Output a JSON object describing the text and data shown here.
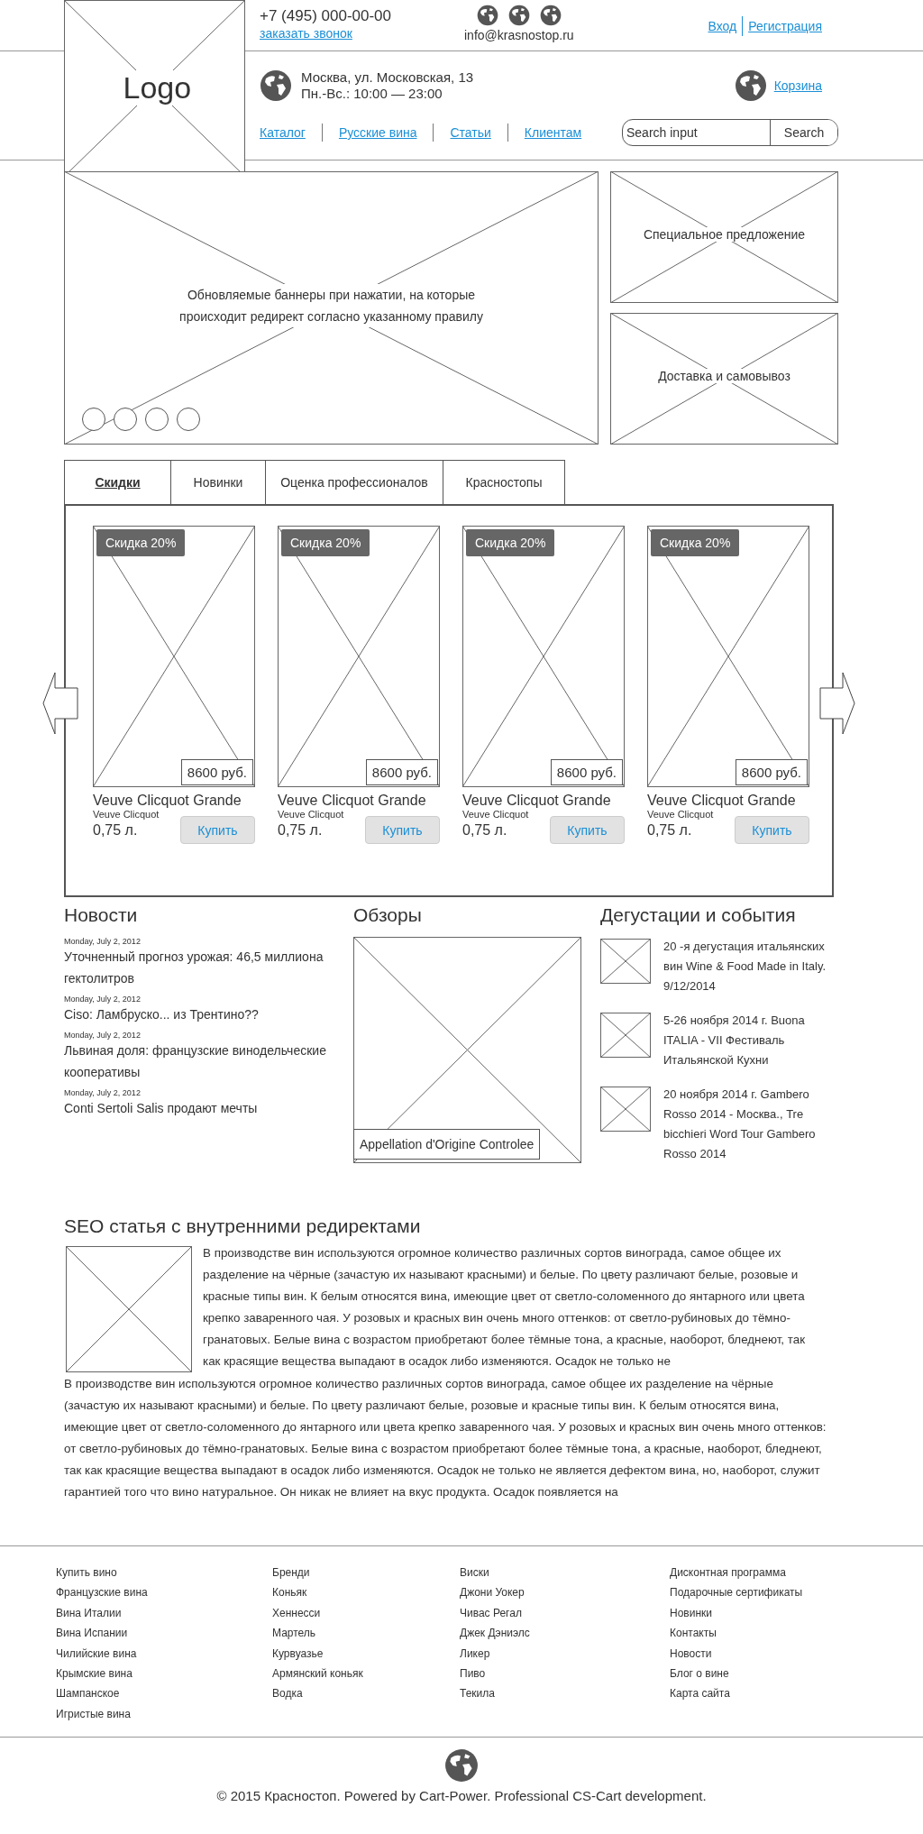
{
  "header": {
    "logo": "Logo",
    "phone": "+7 (495) 000-00-00",
    "callback_link": "заказать звонок",
    "email": "info@krasnostop.ru",
    "auth": [
      "Вход",
      "Регистрация"
    ],
    "address": "Москва, ул. Московская, 13",
    "hours": "Пн.-Вс.: 10:00 — 23:00",
    "cart": "Корзина"
  },
  "nav": [
    "Каталог",
    "Русские вина",
    "Статьи",
    "Клиентам"
  ],
  "search": {
    "placeholder": "Search input",
    "button": "Search"
  },
  "banner": {
    "text": "Обновляемые баннеры при нажатии, на которые происходит редирект согласно указанному правилу"
  },
  "promos": [
    "Специальное предложение",
    "Доставка и самовывоз"
  ],
  "tabs": [
    {
      "label": "Скидки",
      "selected": true
    },
    {
      "label": "Новинки",
      "selected": false
    },
    {
      "label": "Оценка профессионалов",
      "selected": false
    },
    {
      "label": "Красностопы",
      "selected": false
    }
  ],
  "products": [
    {
      "badge": "Скидка 20%",
      "price": "8600 руб.",
      "name": "Veuve Clicquot Grande",
      "brand": "Veuve Clicquot",
      "volume": "0,75 л.",
      "button": "Купить"
    },
    {
      "badge": "Скидка 20%",
      "price": "8600 руб.",
      "name": "Veuve Clicquot Grande",
      "brand": "Veuve Clicquot",
      "volume": "0,75 л.",
      "button": "Купить"
    },
    {
      "badge": "Скидка 20%",
      "price": "8600 руб.",
      "name": "Veuve Clicquot Grande",
      "brand": "Veuve Clicquot",
      "volume": "0,75 л.",
      "button": "Купить"
    },
    {
      "badge": "Скидка 20%",
      "price": "8600 руб.",
      "name": "Veuve Clicquot Grande",
      "brand": "Veuve Clicquot",
      "volume": "0,75 л.",
      "button": "Купить"
    }
  ],
  "news": {
    "title": "Новости",
    "items": [
      {
        "date": "Monday, July 2, 2012",
        "title": "Уточненный прогноз урожая: 46,5 миллиона гектолитров"
      },
      {
        "date": "Monday, July 2, 2012",
        "title": "Ciso: Ламбруско... из Трентино??"
      },
      {
        "date": "Monday, July 2, 2012",
        "title": "Львиная доля: французские винодельческие кооперативы"
      },
      {
        "date": "Monday, July 2, 2012",
        "title": "Conti Sertoli Salis продают мечты"
      }
    ]
  },
  "reviews": {
    "title": "Обзоры",
    "caption": "Appellation d'Origine Controlee"
  },
  "events": {
    "title": "Дегустации и события",
    "items": [
      "20 -я дегустация итальянских вин Wine & Food Made in Italy. 9/12/2014",
      "5-26 ноября 2014 г. Buona ITALIA - VII Фестиваль Итальянской Кухни",
      "20 ноября 2014 г. Gambero Rosso 2014 - Москва., Tre bicchieri Word Tour Gambero Rosso 2014"
    ]
  },
  "seo": {
    "title": "SEO статья с внутренними редиректами",
    "paragraphs": [
      "В производстве вин используются огромное количество различных сортов винограда, самое общее их разделение на чёрные (зачастую их называют красными) и белые. По цвету различают белые, розовые и красные типы вин. К белым относятся вина, имеющие цвет от светло-соломенного до янтарного или цвета крепко заваренного чая. У розовых и красных вин очень много оттенков: от светло-рубиновых до тёмно-гранатовых. Белые вина с возрастом приобретают более тёмные тона, а красные, наоборот, бледнеют, так как красящие вещества выпадают в осадок либо изменяются. Осадок не только не",
      "В производстве вин используются огромное количество различных сортов винограда, самое общее их разделение на чёрные (зачастую их называют красными) и белые. По цвету различают белые, розовые и красные типы вин. К белым относятся вина, имеющие цвет от светло-соломенного до янтарного или цвета крепко заваренного чая. У розовых и красных вин очень много оттенков: от светло-рубиновых до тёмно-гранатовых. Белые вина с возрастом приобретают более тёмные тона, а красные, наоборот, бледнеют, так как красящие вещества выпадают в осадок либо изменяются. Осадок не только не является дефектом вина, но, наоборот, служит гарантией того что вино натуральное. Он никак не влияет на вкус продукта. Осадок появляется на"
    ]
  },
  "footer": {
    "columns": [
      [
        "Купить вино",
        "Французские вина",
        "Вина Италии",
        "Вина Испании",
        "Чилийские вина",
        "Крымские вина",
        "Шампанское",
        "Игристые вина"
      ],
      [
        "Бренди",
        "Коньяк",
        "Хеннесси",
        "Мартель",
        "Курвуазье",
        "Армянский коньяк",
        "Водка"
      ],
      [
        "Виски",
        "Джони Уокер",
        "Чивас Регал",
        "Джек Дэниэлс",
        "Ликер",
        "Пиво",
        "Текила"
      ],
      [
        "Дисконтная программа",
        "Подарочные сертификаты",
        "Новинки",
        "Контакты",
        "Новости",
        "Блог о вине",
        "Карта сайта"
      ]
    ],
    "copyright": "© 2015 Красностоп. Powered by Cart-Power. Professional CS-Cart development."
  }
}
